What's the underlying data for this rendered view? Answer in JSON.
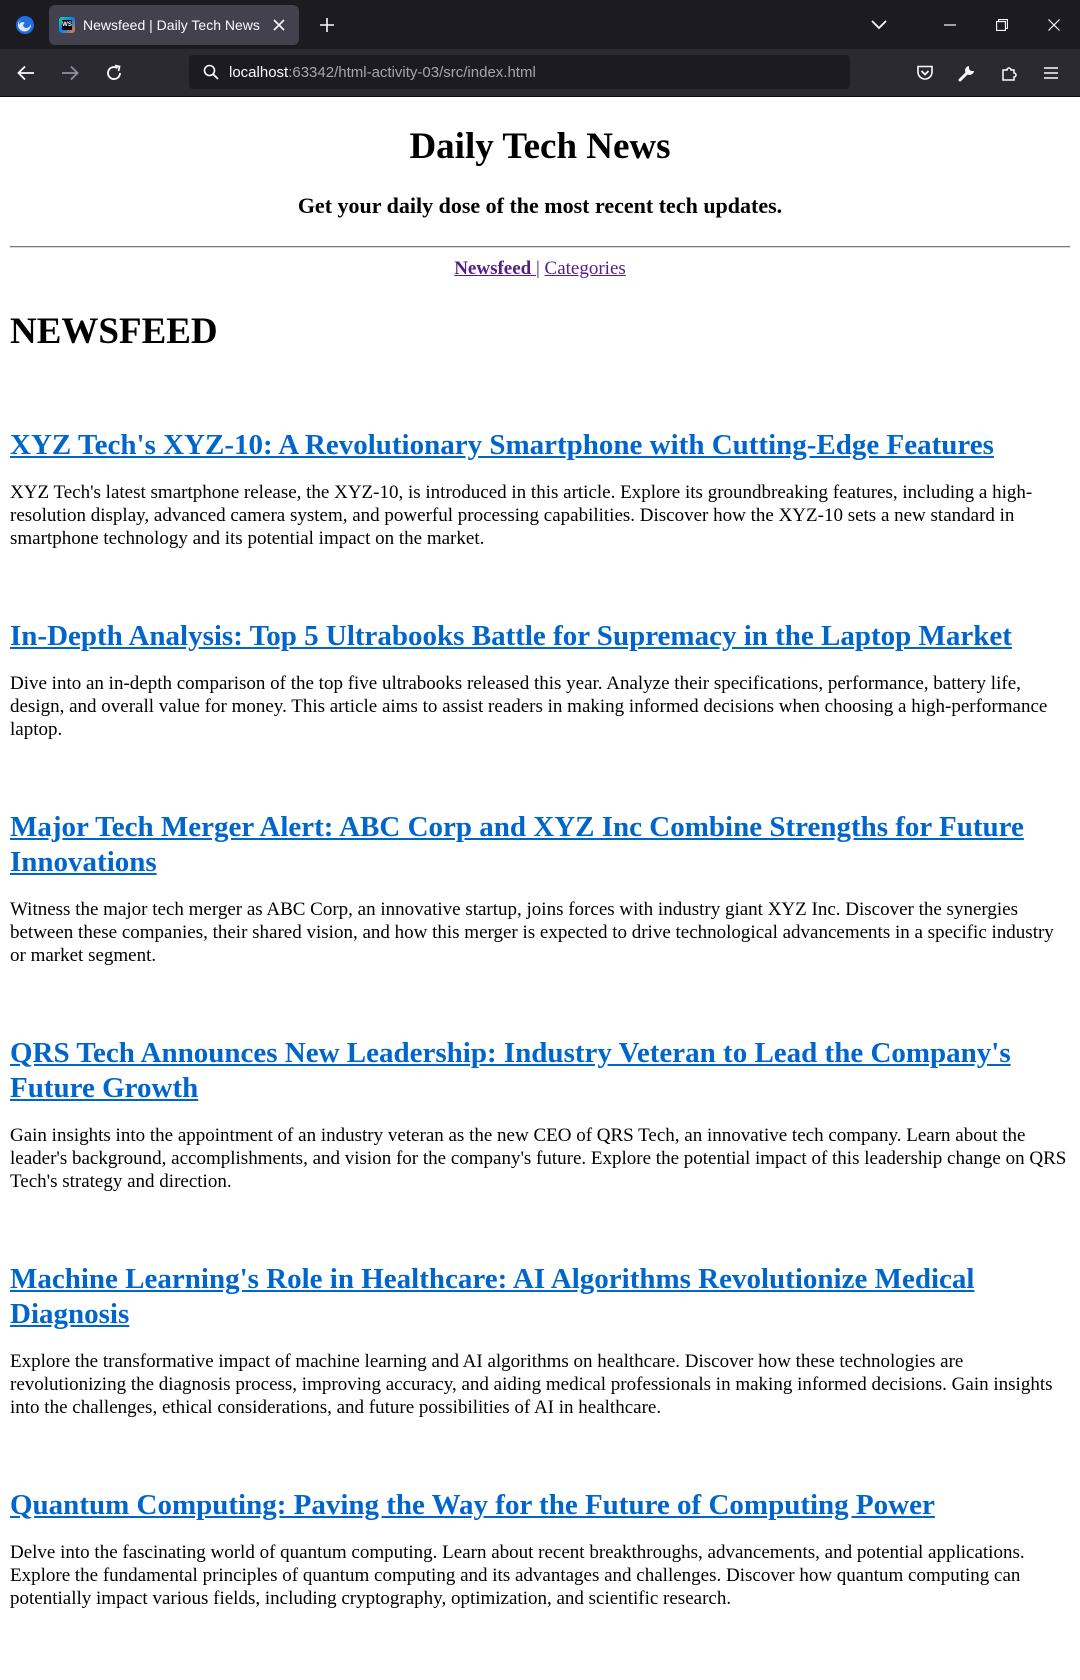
{
  "browser": {
    "tab_title": "Newsfeed | Daily Tech News",
    "url_host": "localhost",
    "url_rest": ":63342/html-activity-03/src/index.html"
  },
  "header": {
    "title": "Daily Tech News",
    "tagline": "Get your daily dose of the most recent tech updates."
  },
  "nav": {
    "newsfeed": "Newsfeed ",
    "separator": "|",
    "categories": "Categories"
  },
  "main": {
    "section_title": "NEWSFEED",
    "articles": [
      {
        "title": "XYZ Tech's XYZ-10: A Revolutionary Smartphone with Cutting-Edge Features",
        "summary": "XYZ Tech's latest smartphone release, the XYZ-10, is introduced in this article. Explore its groundbreaking features, including a high-resolution display, advanced camera system, and powerful processing capabilities. Discover how the XYZ-10 sets a new standard in smartphone technology and its potential impact on the market."
      },
      {
        "title": "In-Depth Analysis: Top 5 Ultrabooks Battle for Supremacy in the Laptop Market",
        "summary": "Dive into an in-depth comparison of the top five ultrabooks released this year. Analyze their specifications, performance, battery life, design, and overall value for money. This article aims to assist readers in making informed decisions when choosing a high-performance laptop."
      },
      {
        "title": "Major Tech Merger Alert: ABC Corp and XYZ Inc Combine Strengths for Future Innovations",
        "summary": "Witness the major tech merger as ABC Corp, an innovative startup, joins forces with industry giant XYZ Inc. Discover the synergies between these companies, their shared vision, and how this merger is expected to drive technological advancements in a specific industry or market segment."
      },
      {
        "title": "QRS Tech Announces New Leadership: Industry Veteran to Lead the Company's Future Growth",
        "summary": "Gain insights into the appointment of an industry veteran as the new CEO of QRS Tech, an innovative tech company. Learn about the leader's background, accomplishments, and vision for the company's future. Explore the potential impact of this leadership change on QRS Tech's strategy and direction."
      },
      {
        "title": "Machine Learning's Role in Healthcare: AI Algorithms Revolutionize Medical Diagnosis",
        "summary": "Explore the transformative impact of machine learning and AI algorithms on healthcare. Discover how these technologies are revolutionizing the diagnosis process, improving accuracy, and aiding medical professionals in making informed decisions. Gain insights into the challenges, ethical considerations, and future possibilities of AI in healthcare."
      },
      {
        "title": "Quantum Computing: Paving the Way for the Future of Computing Power",
        "summary": "Delve into the fascinating world of quantum computing. Learn about recent breakthroughs, advancements, and potential applications. Explore the fundamental principles of quantum computing and its advantages and challenges. Discover how quantum computing can potentially impact various fields, including cryptography, optimization, and scientific research."
      }
    ]
  }
}
